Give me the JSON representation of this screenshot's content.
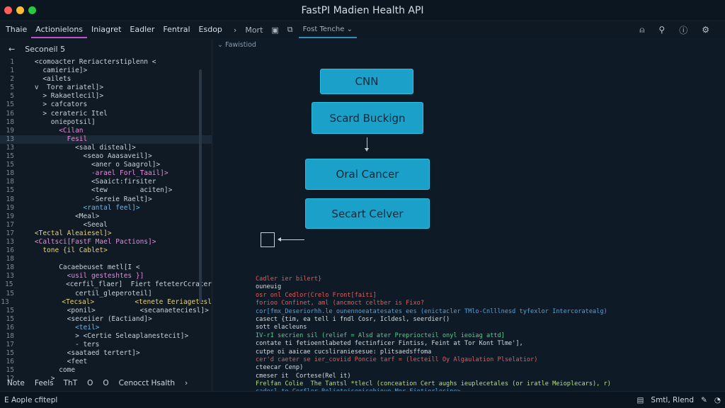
{
  "window": {
    "title": "FastPI Madien Health API"
  },
  "menubar": {
    "items": [
      "Thaie",
      "Actionielons",
      "Iniagret",
      "Eadler",
      "Fentral",
      "Esdop"
    ],
    "toolbar_text": "Mort",
    "tab": "Fost Tenche",
    "tab_caret": "⌄"
  },
  "editor": {
    "header": "Seconeil 5",
    "lines": [
      {
        "n": "1",
        "t": "    <comoacter Reriacterstiplenn <",
        "c": ""
      },
      {
        "n": "1",
        "t": "      camieriie]>",
        "c": ""
      },
      {
        "n": "2",
        "t": "      <ailets",
        "c": ""
      },
      {
        "n": "5",
        "t": "    v  Tore ariatel]>",
        "c": ""
      },
      {
        "n": "5",
        "t": "      > Rakaetlecil]>",
        "c": ""
      },
      {
        "n": "15",
        "t": "      > cafcators",
        "c": ""
      },
      {
        "n": "16",
        "t": "      > cerateric Itel",
        "c": ""
      },
      {
        "n": "18",
        "t": "        oniepotsil]",
        "c": ""
      },
      {
        "n": "19",
        "t": "          <Cilan",
        "c": "kw"
      },
      {
        "n": "13",
        "t": "            Fesil",
        "c": "kw"
      },
      {
        "n": "13",
        "t": "              <saal disteal]>",
        "c": ""
      },
      {
        "n": "15",
        "t": "                <seao Aaasaveil]>",
        "c": ""
      },
      {
        "n": "15",
        "t": "                  <aner o Saagrol]>",
        "c": ""
      },
      {
        "n": "18",
        "t": "                  -arael Forl_Taail]>",
        "c": "kw"
      },
      {
        "n": "18",
        "t": "                  <Saaict:firsiter",
        "c": ""
      },
      {
        "n": "15",
        "t": "                  <tew        aciten]>",
        "c": ""
      },
      {
        "n": "18",
        "t": "                  -Sereie Raelt]>",
        "c": ""
      },
      {
        "n": "19",
        "t": "                <rantal feel]>",
        "c": "bl"
      },
      {
        "n": "19",
        "t": "              <Meal>",
        "c": ""
      },
      {
        "n": "17",
        "t": "                <Seeal",
        "c": ""
      },
      {
        "n": "17",
        "t": "    <Tectal Aleaiesel]>",
        "c": "yl"
      },
      {
        "n": "13",
        "t": "    <Caltsci[FastF Mael Pactions]>",
        "c": "kw"
      },
      {
        "n": "16",
        "t": "      tone {il Cablet>",
        "c": "yl"
      },
      {
        "n": "18",
        "t": "",
        "c": ""
      },
      {
        "n": "18",
        "t": "          Cacaebeuset metl[I <",
        "c": ""
      },
      {
        "n": "13",
        "t": "            <usil gesteshtes }]",
        "c": "kw"
      },
      {
        "n": "15",
        "t": "            <cerfil_flaer]  Fiert feteterCcrater",
        "c": ""
      },
      {
        "n": "15",
        "t": "              certil_gleperoteil]",
        "c": ""
      },
      {
        "n": "13",
        "t": "            <Tecsal>          <tenete Eeriagetesl",
        "c": "yl"
      },
      {
        "n": "15",
        "t": "            <ponil>           <secanaeteciesl]>",
        "c": ""
      },
      {
        "n": "15",
        "t": "            <seceiier (Eactiand]>",
        "c": ""
      },
      {
        "n": "16",
        "t": "              <teil>",
        "c": "bl"
      },
      {
        "n": "18",
        "t": "              > <Certie Seleaplanestecit]>",
        "c": ""
      },
      {
        "n": "17",
        "t": "              - ters",
        "c": ""
      },
      {
        "n": "15",
        "t": "            <saataed tertert]>",
        "c": ""
      },
      {
        "n": "16",
        "t": "            <feet",
        "c": ""
      },
      {
        "n": "15",
        "t": "          come",
        "c": ""
      },
      {
        "n": "12",
        "t": "        >",
        "c": ""
      }
    ],
    "footer": [
      "Note",
      "Feels",
      "ThT",
      "O",
      "O",
      "Cenocct Hsalth",
      "›"
    ]
  },
  "main": {
    "crumb": "Fawistiod",
    "boxes": [
      "CNN",
      "Scard Buckign",
      "Oral Cancer",
      "Secart Celver"
    ],
    "console": [
      {
        "t": "Cadler ier bilert}",
        "c": "c-red"
      },
      {
        "t": "ouneuig",
        "c": "c-white"
      },
      {
        "t": "osr onl Cedlor(Crelo Front[faiti]",
        "c": "c-red"
      },
      {
        "t": "forioo Confinet, aml (ancmoct celtber is Fixo?",
        "c": "c-red"
      },
      {
        "t": "cor[fmx_Deseriorhh.le ounennoeatatesates ees (enictacler TMlo-Cnlllnesd tyfexlor Intercoratealg)",
        "c": "c-blue"
      },
      {
        "t": "casect {tim, ea tell i fndl Cosr, Icldesl, seerdier()",
        "c": "c-white"
      },
      {
        "t": "sott elacleuns",
        "c": "c-white"
      },
      {
        "t": "IV-rI secrien sil (relief = Alsd ater Prepriocteil onyl ieoiag attd]",
        "c": "c-green"
      },
      {
        "t": "contate ti fetioentlabeted fectinficer Fintiss, Feint at Tor Kont Tlme'],",
        "c": "c-white"
      },
      {
        "t": "cutpe oi aaicae cucsliraniesesue: plitsaedsffoma",
        "c": "c-white"
      },
      {
        "t": "cer'd caeter se ier_coviid Poncie tarf = (lecteill Oy Algaulation Plselatior)",
        "c": "c-red"
      },
      {
        "t": "cteecar Cenp)",
        "c": "c-white"
      },
      {
        "t": "cmeser it  Cortese(Rel it)",
        "c": "c-white"
      },
      {
        "t": "Frelfan Colie  The Tantsl *tlecl (conceation Cert aughs ieuplecetales (or iratle Meioplecars), r)",
        "c": "c-lime"
      },
      {
        "t": "cadesl to Cerfler Relioteisenisebiouo-Mer Fiotiorlecipe>",
        "c": "c-blue"
      }
    ]
  },
  "statusbar": {
    "left": "E Aople cfitepl",
    "right_text": "Smtl, Rlend",
    "colors": {
      "accent": "#1aa0c9",
      "tab_underline": "#c052c9"
    }
  }
}
